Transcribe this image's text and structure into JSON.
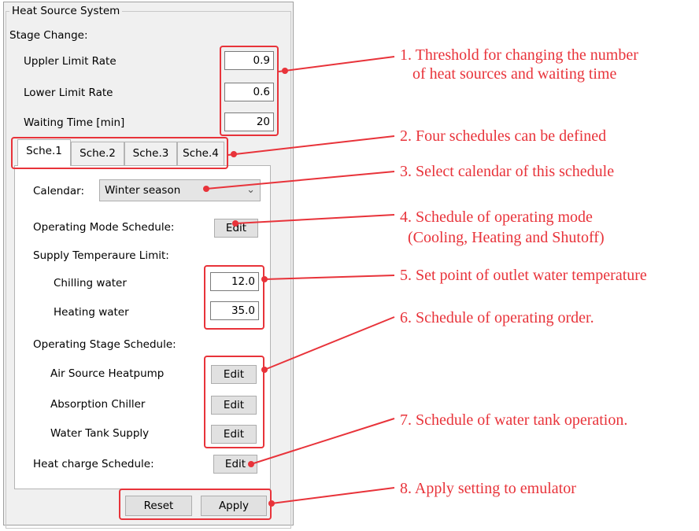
{
  "panel": {
    "group_title": "Heat Source System",
    "stage_change_label": "Stage Change:",
    "upper_limit_label": "Uppler Limit Rate",
    "upper_limit_value": "0.9",
    "lower_limit_label": "Lower Limit Rate",
    "lower_limit_value": "0.6",
    "waiting_time_label": "Waiting Time [min]",
    "waiting_time_value": "20"
  },
  "tabs": [
    {
      "label": "Sche.1",
      "active": true
    },
    {
      "label": "Sche.2",
      "active": false
    },
    {
      "label": "Sche.3",
      "active": false
    },
    {
      "label": "Sche.4",
      "active": false
    }
  ],
  "schedule": {
    "calendar_label": "Calendar:",
    "calendar_value": "Winter season",
    "operating_mode_label": "Operating Mode Schedule:",
    "supply_temp_label": "Supply Temperaure Limit:",
    "chilling_label": "Chilling water",
    "chilling_value": "12.0",
    "heating_label": "Heating water",
    "heating_value": "35.0",
    "operating_stage_label": "Operating Stage Schedule:",
    "air_source_label": "Air Source Heatpump",
    "absorption_label": "Absorption Chiller",
    "water_tank_label": "Water Tank Supply",
    "heat_charge_label": "Heat charge Schedule:",
    "edit_label": "Edit"
  },
  "buttons": {
    "reset": "Reset",
    "apply": "Apply"
  },
  "annotations": {
    "a1_line1": "1. Threshold for changing the number",
    "a1_line2": "of heat sources and waiting time",
    "a2": "2. Four schedules can be defined",
    "a3": "3. Select calendar of this schedule",
    "a4_line1": "4. Schedule of operating mode",
    "a4_line2": "(Cooling, Heating and Shutoff)",
    "a5": "5. Set point of outlet water temperature",
    "a6": "6. Schedule of operating order.",
    "a7": "7. Schedule of water tank operation.",
    "a8": "8. Apply setting to emulator"
  },
  "colors": {
    "annotation": "#e8333a",
    "panel_bg": "#f0f0f0"
  }
}
